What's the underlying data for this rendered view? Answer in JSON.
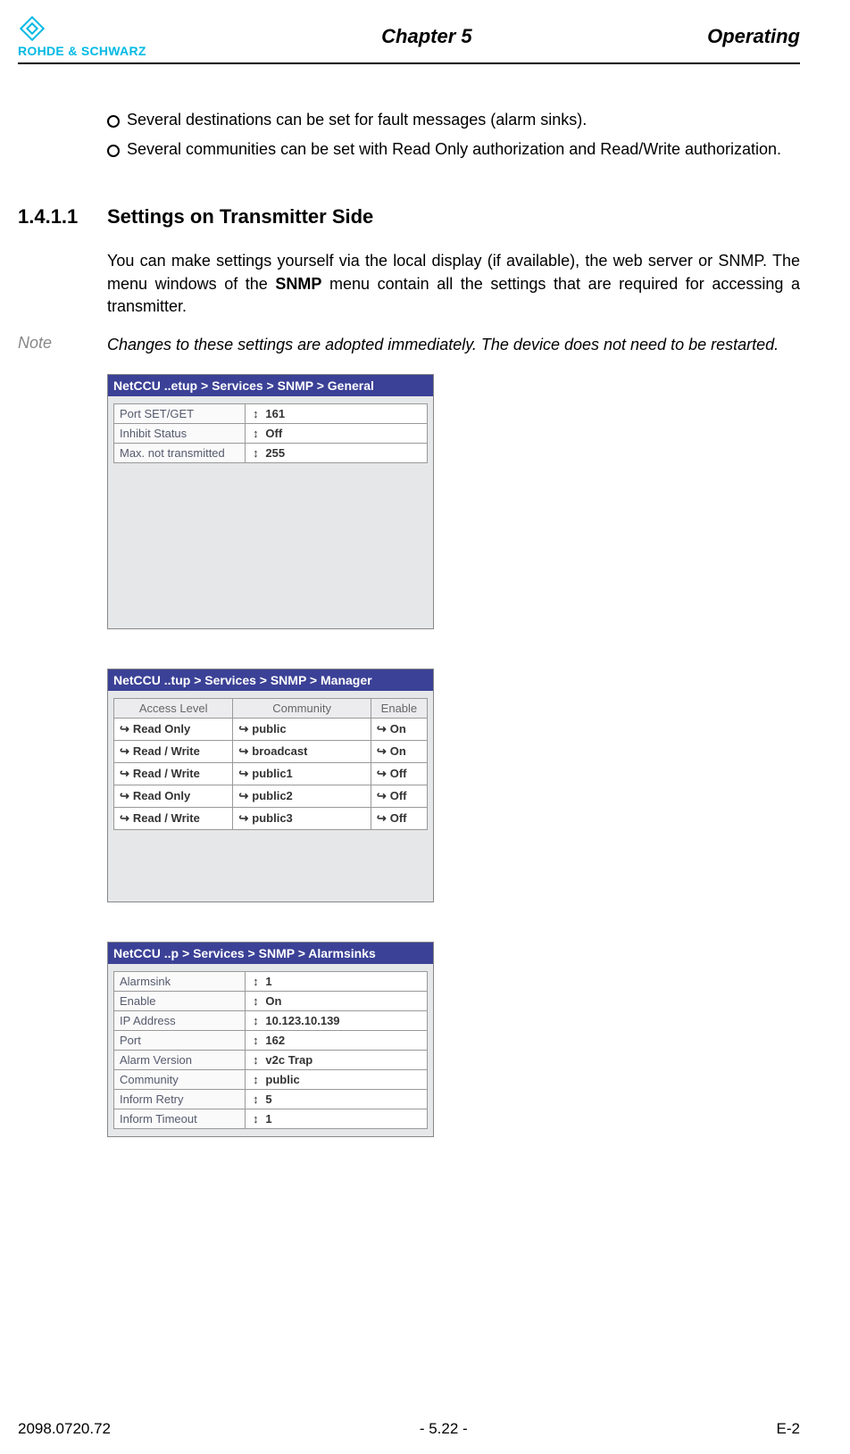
{
  "header": {
    "brand": "ROHDE & SCHWARZ",
    "chapter": "Chapter 5",
    "right": "Operating"
  },
  "bullets": [
    "Several destinations can be set for fault messages (alarm sinks).",
    "Several communities can be set with Read Only authorization and Read/Write authorization."
  ],
  "section": {
    "number": "1.4.1.1",
    "title": "Settings on Transmitter Side"
  },
  "para1_a": "You can make settings yourself via the local display (if available), the web server or SNMP. The menu windows of the ",
  "para1_bold": "SNMP",
  "para1_b": " menu contain all the settings that are required for accessing a transmitter.",
  "note": {
    "label": "Note",
    "text": "Changes to these settings are adopted immediately. The device does not need to be restarted."
  },
  "shot1": {
    "title": "NetCCU ..etup > Services > SNMP > General",
    "rows": [
      {
        "label": "Port SET/GET",
        "value": "161"
      },
      {
        "label": "Inhibit Status",
        "value": "Off"
      },
      {
        "label": "Max. not transmitted",
        "value": "255"
      }
    ]
  },
  "shot2": {
    "title": "NetCCU ..tup > Services > SNMP > Manager",
    "headers": [
      "Access Level",
      "Community",
      "Enable"
    ],
    "rows": [
      {
        "access": "Read Only",
        "community": "public",
        "enable": "On"
      },
      {
        "access": "Read / Write",
        "community": "broadcast",
        "enable": "On"
      },
      {
        "access": "Read / Write",
        "community": "public1",
        "enable": "Off"
      },
      {
        "access": "Read Only",
        "community": "public2",
        "enable": "Off"
      },
      {
        "access": "Read / Write",
        "community": "public3",
        "enable": "Off"
      }
    ]
  },
  "shot3": {
    "title": "NetCCU ..p > Services > SNMP > Alarmsinks",
    "rows": [
      {
        "label": "Alarmsink",
        "value": "1"
      },
      {
        "label": "Enable",
        "value": "On"
      },
      {
        "label": "IP Address",
        "value": "10.123.10.139"
      },
      {
        "label": "Port",
        "value": "162"
      },
      {
        "label": "Alarm Version",
        "value": "v2c Trap"
      },
      {
        "label": "Community",
        "value": "public"
      },
      {
        "label": "Inform Retry",
        "value": "5"
      },
      {
        "label": "Inform Timeout",
        "value": "1"
      }
    ]
  },
  "footer": {
    "left": "2098.0720.72",
    "center": "- 5.22 -",
    "right": "E-2"
  }
}
